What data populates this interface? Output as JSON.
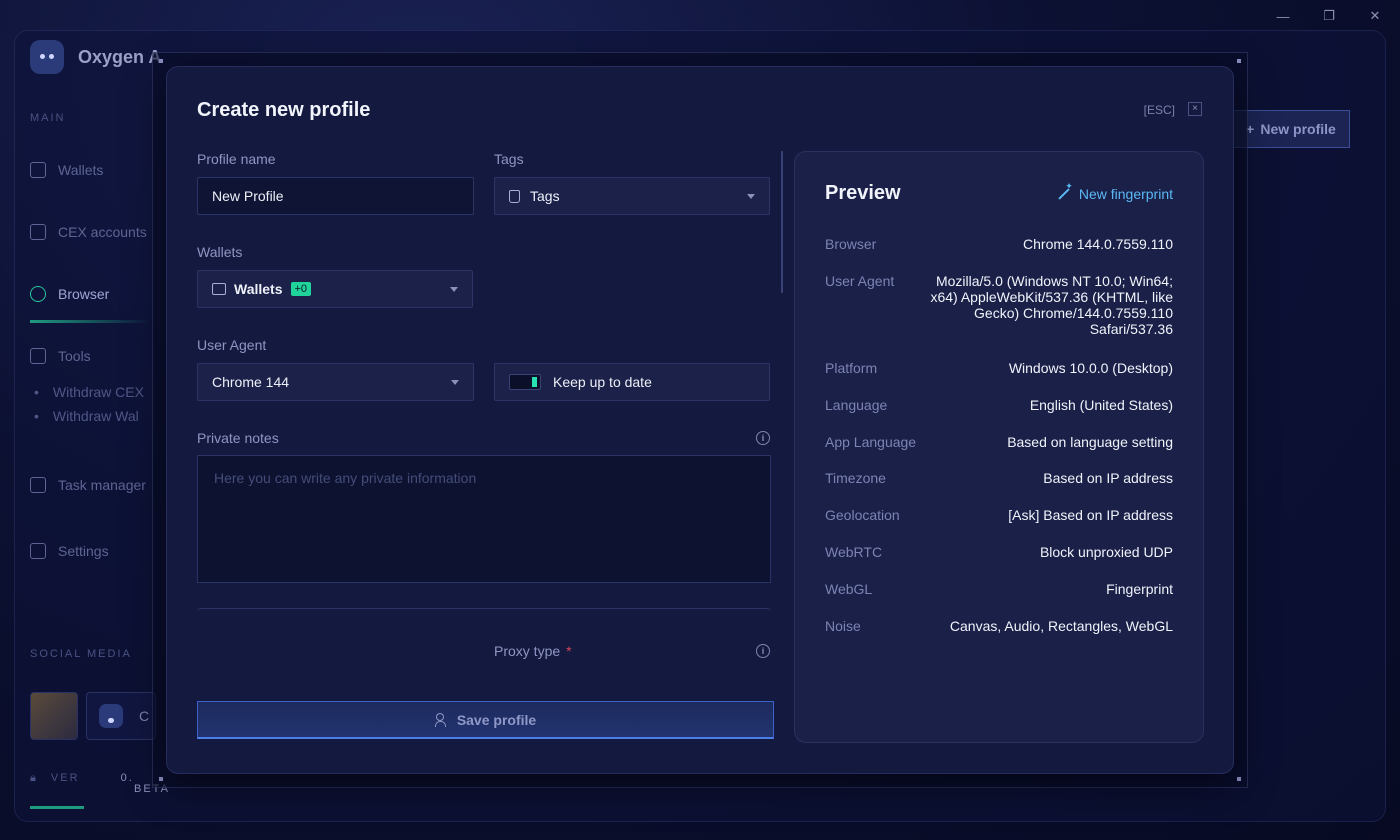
{
  "app": {
    "name": "Oxygen A"
  },
  "sidebar": {
    "section_main": "MAIN",
    "items": [
      {
        "label": "Wallets"
      },
      {
        "label": "CEX accounts"
      },
      {
        "label": "Browser"
      },
      {
        "label": "Tools"
      },
      {
        "label": "Task manager"
      },
      {
        "label": "Settings"
      }
    ],
    "tools_sub": [
      "Withdraw CEX",
      "Withdraw Wal"
    ],
    "section_social": "SOCIAL MEDIA",
    "social_second": "C",
    "version_label": "VER",
    "version_value": "0.",
    "version_channel": "BETA"
  },
  "header": {
    "new_profile_label": "New profile"
  },
  "modal": {
    "title": "Create new profile",
    "esc_label": "[ESC]",
    "close_glyph": "×",
    "profile_name": {
      "label": "Profile name",
      "value": "New Profile"
    },
    "tags": {
      "label": "Tags",
      "value": "Tags"
    },
    "wallets": {
      "label": "Wallets",
      "value": "Wallets",
      "badge": "+0"
    },
    "user_agent": {
      "label": "User Agent",
      "value": "Chrome 144"
    },
    "keep_up_to_date": {
      "label": "Keep up to date",
      "enabled": true
    },
    "private_notes": {
      "label": "Private notes",
      "placeholder": "Here you can write any private information"
    },
    "proxy_type": {
      "label": "Proxy type",
      "required_mark": "*"
    },
    "save_label": "Save profile",
    "info_glyph": "i"
  },
  "preview": {
    "title": "Preview",
    "new_fingerprint_label": "New fingerprint",
    "rows": [
      {
        "key": "Browser",
        "value": "Chrome 144.0.7559.110"
      },
      {
        "key": "User Agent",
        "value": "Mozilla/5.0 (Windows NT 10.0; Win64; x64) AppleWebKit/537.36 (KHTML, like Gecko) Chrome/144.0.7559.110 Safari/537.36"
      },
      {
        "key": "Platform",
        "value": "Windows 10.0.0 (Desktop)"
      },
      {
        "key": "Language",
        "value": "English (United States)"
      },
      {
        "key": "App Language",
        "value": "Based on language setting"
      },
      {
        "key": "Timezone",
        "value": "Based on IP address"
      },
      {
        "key": "Geolocation",
        "value": "[Ask] Based on IP address"
      },
      {
        "key": "WebRTC",
        "value": "Block unproxied UDP"
      },
      {
        "key": "WebGL",
        "value": "Fingerprint"
      },
      {
        "key": "Noise",
        "value": "Canvas, Audio, Rectangles, WebGL"
      }
    ]
  },
  "colors": {
    "accent_green": "#1fd39a",
    "accent_blue": "#5bb8f5",
    "required_red": "#d2455a"
  }
}
